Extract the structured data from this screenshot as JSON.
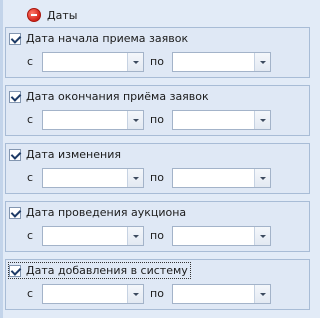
{
  "section": {
    "title": "Даты",
    "collapse_icon": "minus-circle-icon"
  },
  "range_labels": {
    "from": "с",
    "to": "по"
  },
  "groups": [
    {
      "label": "Дата начала приема заявок",
      "checked": true,
      "focused": false,
      "from_value": "",
      "to_value": ""
    },
    {
      "label": "Дата окончания приёма заявок",
      "checked": true,
      "focused": false,
      "from_value": "",
      "to_value": ""
    },
    {
      "label": "Дата изменения",
      "checked": true,
      "focused": false,
      "from_value": "",
      "to_value": ""
    },
    {
      "label": "Дата проведения аукциона",
      "checked": true,
      "focused": false,
      "from_value": "",
      "to_value": ""
    },
    {
      "label": "Дата добавления в систему",
      "checked": true,
      "focused": true,
      "from_value": "",
      "to_value": ""
    }
  ]
}
